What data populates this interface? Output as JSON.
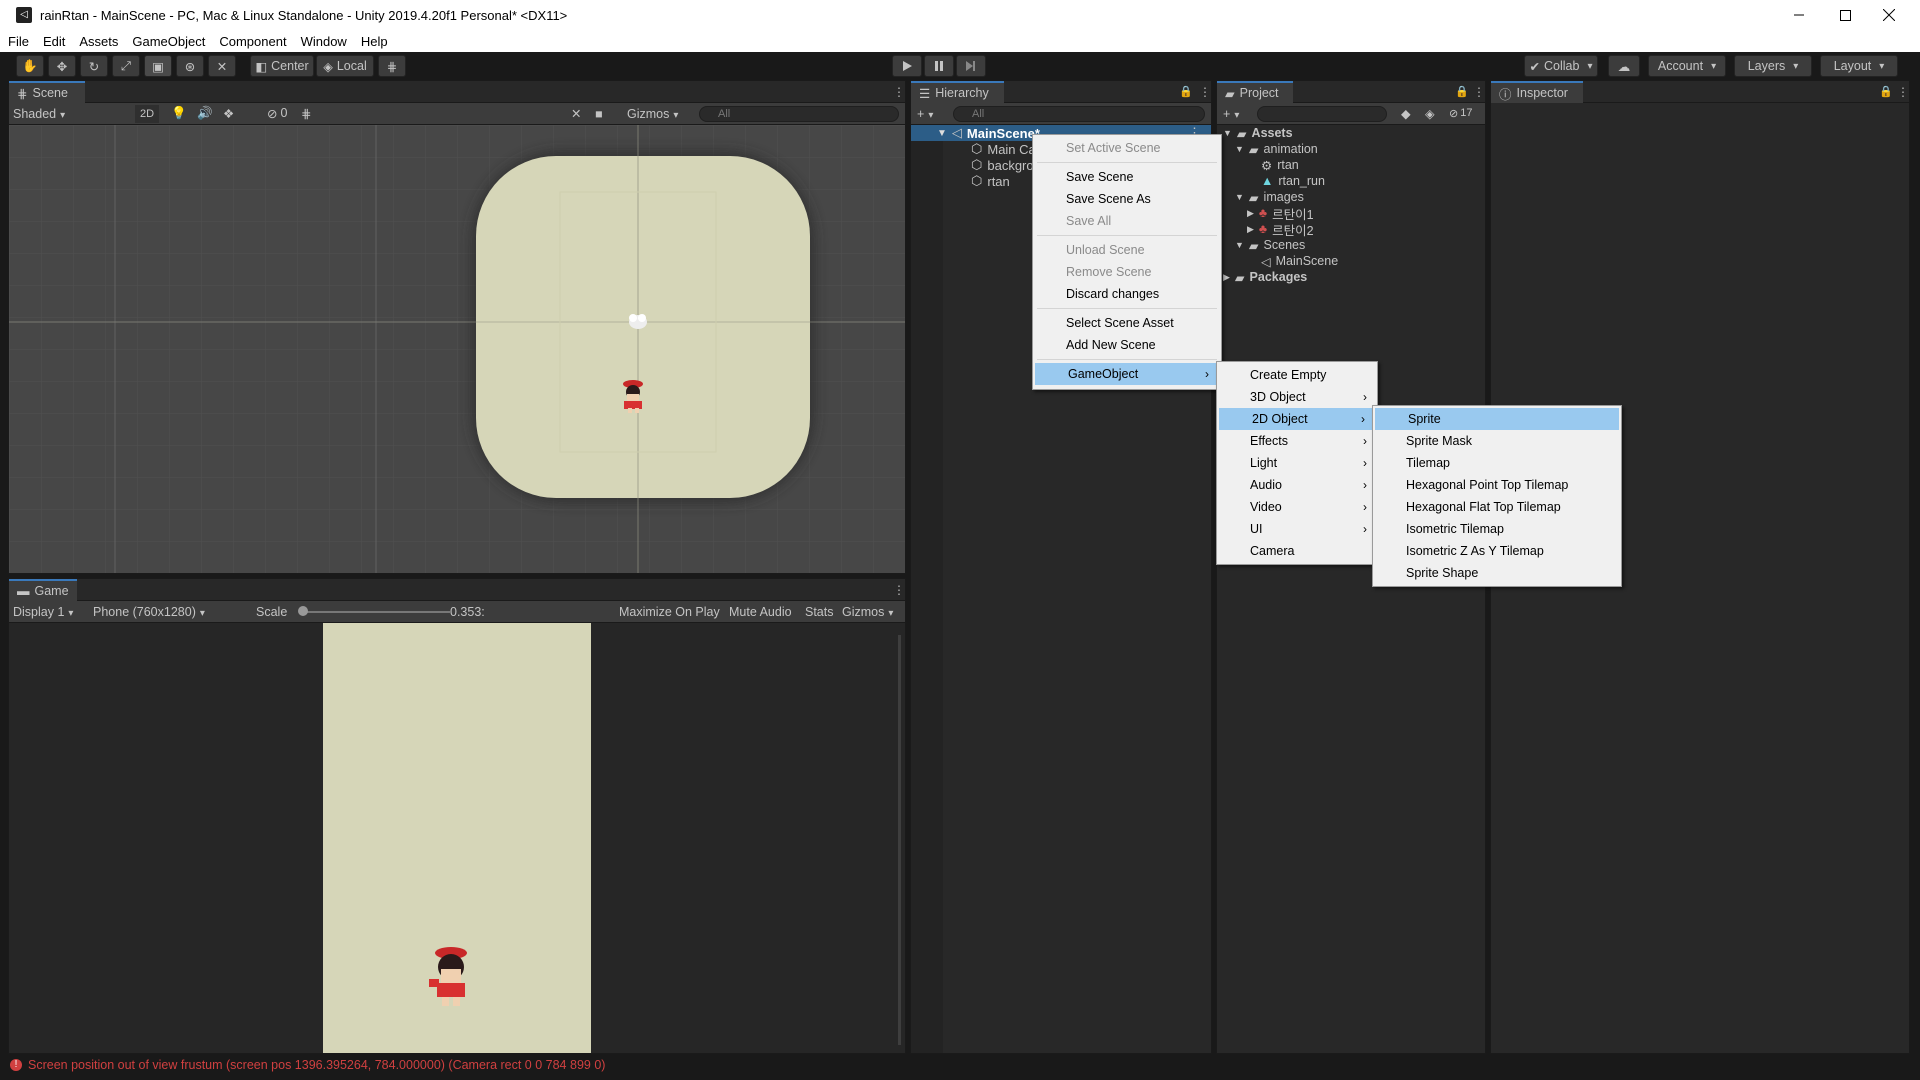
{
  "window": {
    "title": "rainRtan - MainScene - PC, Mac & Linux Standalone - Unity 2019.4.20f1 Personal* <DX11>"
  },
  "menubar": [
    "File",
    "Edit",
    "Assets",
    "GameObject",
    "Component",
    "Window",
    "Help"
  ],
  "toolbar": {
    "center": "Center",
    "local": "Local",
    "collab": "Collab",
    "account": "Account",
    "layers": "Layers",
    "layout": "Layout"
  },
  "scene": {
    "tab": "Scene",
    "shading": "Shaded",
    "mode2d": "2D",
    "hidden_count": "0",
    "gizmos": "Gizmos",
    "search": "All"
  },
  "game": {
    "tab": "Game",
    "display": "Display 1",
    "resolution": "Phone (760x1280)",
    "scale_label": "Scale",
    "scale_value": "0.353:",
    "maximize": "Maximize On Play",
    "mute": "Mute Audio",
    "stats": "Stats",
    "gizmos": "Gizmos",
    "scale_fraction": 0.02
  },
  "hierarchy": {
    "tab": "Hierarchy",
    "search": "All",
    "scene_name": "MainScene*",
    "items": [
      "Main Ca",
      "backgro",
      "rtan"
    ]
  },
  "project": {
    "tab": "Project",
    "hidden_count": "17",
    "tree": [
      {
        "label": "Assets",
        "level": 0,
        "type": "folder-open",
        "bold": true
      },
      {
        "label": "animation",
        "level": 1,
        "type": "folder-open"
      },
      {
        "label": "rtan",
        "level": 2,
        "type": "animator"
      },
      {
        "label": "rtan_run",
        "level": 2,
        "type": "anim"
      },
      {
        "label": "images",
        "level": 1,
        "type": "folder-open"
      },
      {
        "label": "르탄이1",
        "level": 2,
        "type": "sprite"
      },
      {
        "label": "르탄이2",
        "level": 2,
        "type": "sprite"
      },
      {
        "label": "Scenes",
        "level": 1,
        "type": "folder-open"
      },
      {
        "label": "MainScene",
        "level": 2,
        "type": "scene"
      },
      {
        "label": "Packages",
        "level": 0,
        "type": "folder",
        "bold": true
      }
    ]
  },
  "inspector": {
    "tab": "Inspector"
  },
  "context_menu": {
    "groups": [
      [
        {
          "label": "Set Active Scene",
          "disabled": true
        }
      ],
      [
        {
          "label": "Save Scene"
        },
        {
          "label": "Save Scene As"
        },
        {
          "label": "Save All",
          "disabled": true
        }
      ],
      [
        {
          "label": "Unload Scene",
          "disabled": true
        },
        {
          "label": "Remove Scene",
          "disabled": true
        },
        {
          "label": "Discard changes"
        }
      ],
      [
        {
          "label": "Select Scene Asset"
        },
        {
          "label": "Add New Scene"
        }
      ],
      [
        {
          "label": "GameObject",
          "submenu": true,
          "highlighted": true
        }
      ]
    ]
  },
  "gameobject_menu": [
    {
      "label": "Create Empty"
    },
    {
      "label": "3D Object",
      "submenu": true
    },
    {
      "label": "2D Object",
      "submenu": true,
      "highlighted": true
    },
    {
      "label": "Effects",
      "submenu": true
    },
    {
      "label": "Light",
      "submenu": true
    },
    {
      "label": "Audio",
      "submenu": true
    },
    {
      "label": "Video",
      "submenu": true
    },
    {
      "label": "UI",
      "submenu": true
    },
    {
      "label": "Camera"
    }
  ],
  "object2d_menu": [
    {
      "label": "Sprite",
      "highlighted": true
    },
    {
      "label": "Sprite Mask"
    },
    {
      "label": "Tilemap"
    },
    {
      "label": "Hexagonal Point Top Tilemap"
    },
    {
      "label": "Hexagonal Flat Top Tilemap"
    },
    {
      "label": "Isometric Tilemap"
    },
    {
      "label": "Isometric Z As Y Tilemap"
    },
    {
      "label": "Sprite Shape"
    }
  ],
  "status": {
    "message": "Screen position out of view frustum (screen pos 1396.395264, 784.000000) (Camera rect 0 0 784 899 0)"
  },
  "colors": {
    "highlight": "#99c9ef",
    "selected_row": "#2c5d87",
    "background_sprite": "#d6d6b8",
    "error": "#d04040"
  }
}
